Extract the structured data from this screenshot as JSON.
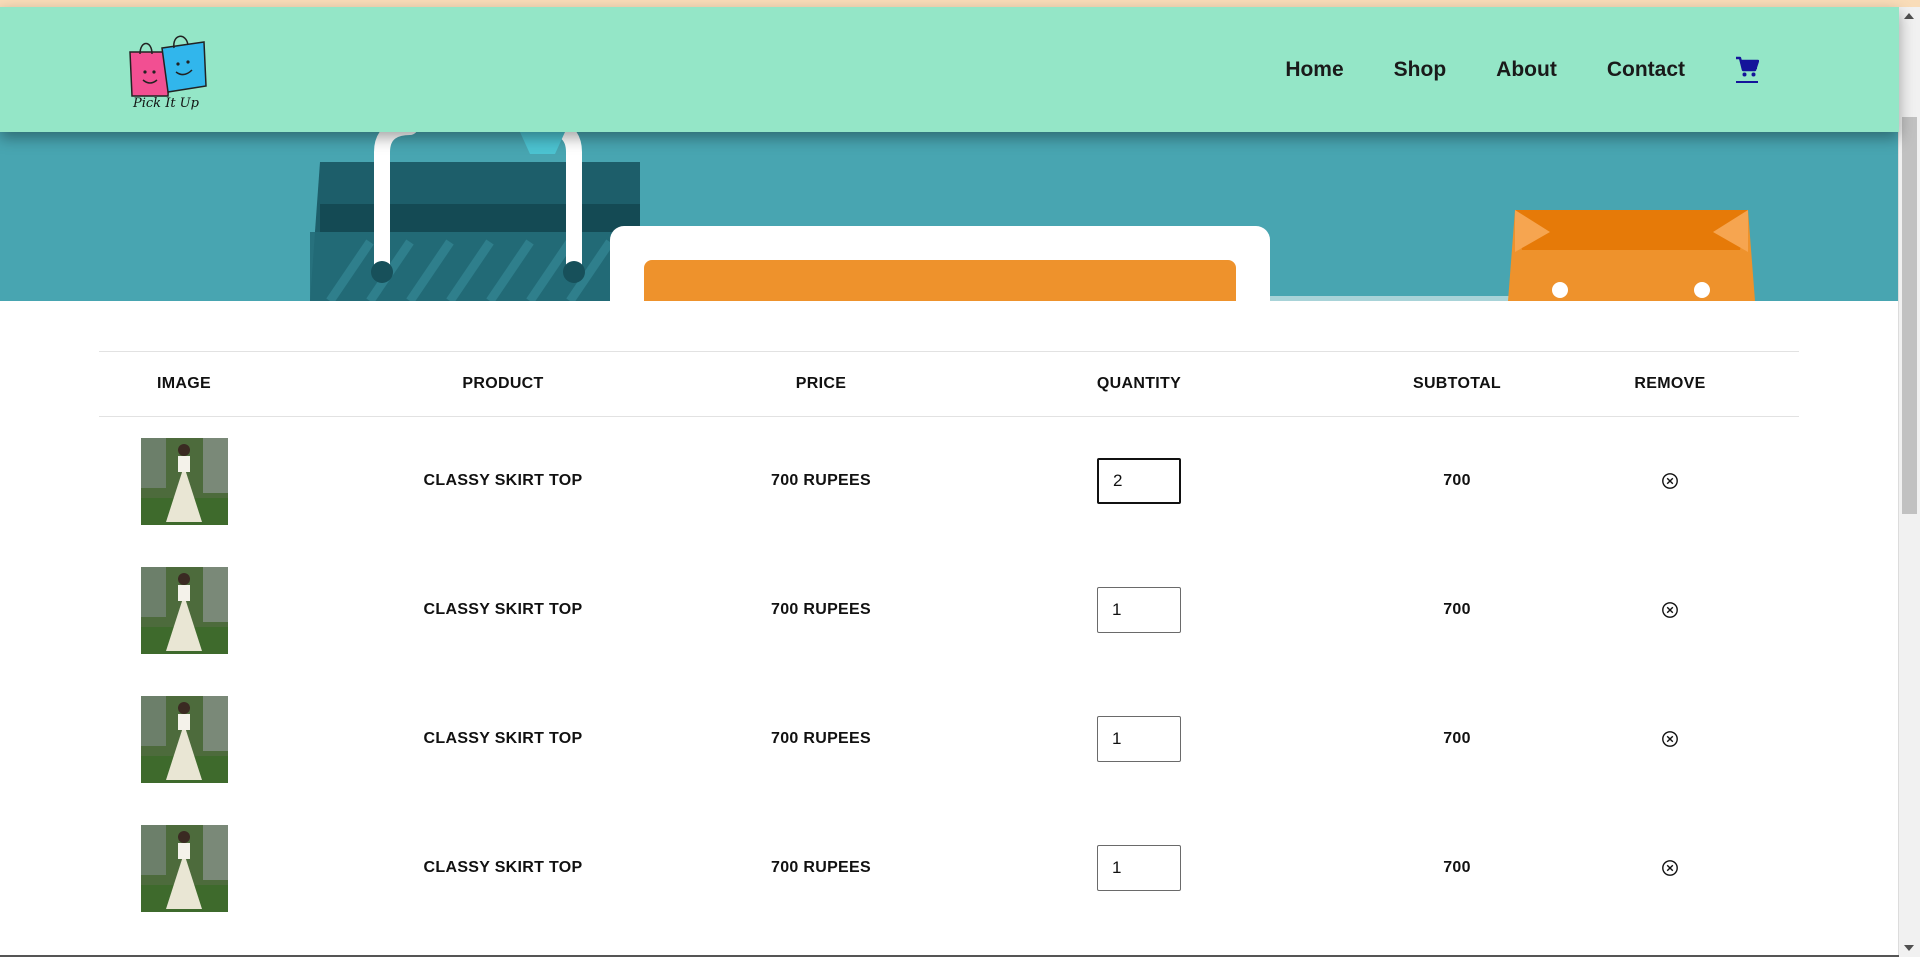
{
  "brand": {
    "logo_text": "Pick It Up"
  },
  "nav": {
    "items": [
      "Home",
      "Shop",
      "About",
      "Contact"
    ],
    "cart_icon": "shopping-cart-icon"
  },
  "cart": {
    "headers": [
      "IMAGE",
      "PRODUCT",
      "PRICE",
      "QUANTITY",
      "SUBTOTAL",
      "REMOVE"
    ],
    "rows": [
      {
        "product": "CLASSY SKIRT TOP",
        "price": "700 RUPEES",
        "quantity": "2",
        "subtotal": "700"
      },
      {
        "product": "CLASSY SKIRT TOP",
        "price": "700 RUPEES",
        "quantity": "1",
        "subtotal": "700"
      },
      {
        "product": "CLASSY SKIRT TOP",
        "price": "700 RUPEES",
        "quantity": "1",
        "subtotal": "700"
      },
      {
        "product": "CLASSY SKIRT TOP",
        "price": "700 RUPEES",
        "quantity": "1",
        "subtotal": "700"
      }
    ]
  },
  "icons": {
    "remove": "remove-circle-x-icon",
    "product_image": "product-photo-icon"
  },
  "colors": {
    "navbar": "#94e6c7",
    "banner": "#48a5b1",
    "cart_icon": "#14149a",
    "top_strip": "#f9dcb8"
  }
}
